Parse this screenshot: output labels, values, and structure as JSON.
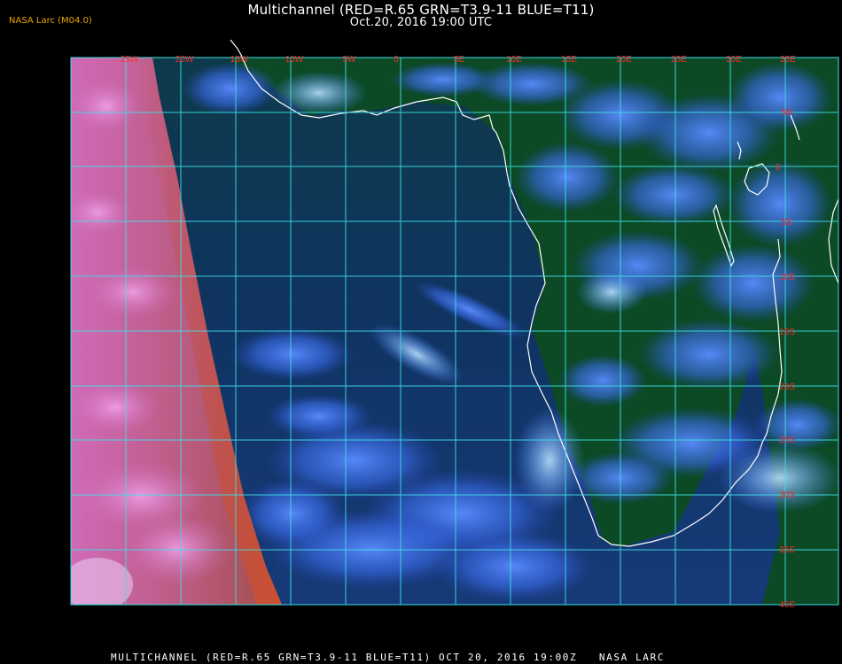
{
  "header": {
    "title": "Multichannel (RED=R.65 GRN=T3.9-11 BLUE=T11)",
    "subtitle": "Oct.20, 2016 19:00 UTC",
    "credit": "NASA Larc (M04.0)"
  },
  "footer": {
    "caption": "MULTICHANNEL (RED=R.65 GRN=T3.9-11 BLUE=T11) OCT 20, 2016 19:00Z   NASA LARC"
  },
  "map": {
    "longitude_labels": [
      "25W",
      "20W",
      "15W",
      "10W",
      "5W",
      "0",
      "5E",
      "10E",
      "15E",
      "20E",
      "25E",
      "30E",
      "35E"
    ],
    "latitude_labels": [
      "5N",
      "0",
      "5S",
      "10S",
      "15S",
      "20S",
      "25S",
      "30S",
      "35S",
      "40S"
    ],
    "colors": {
      "grid": "#3fe0e8",
      "label": "#ff2a2a",
      "coast": "#ffffff",
      "ocean": "#103c5a",
      "land": "#0c4a1c",
      "cloud": "#4a7cff",
      "sunlit": "#d870c0"
    }
  }
}
